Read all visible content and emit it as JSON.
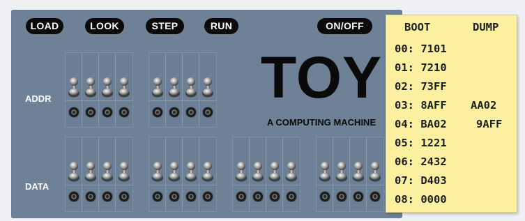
{
  "buttons": {
    "load": "LOAD",
    "look": "LOOK",
    "step": "STEP",
    "run": "RUN",
    "power": "ON/OFF"
  },
  "rows": {
    "addr": "ADDR",
    "data": "DATA"
  },
  "title": "TOY",
  "subtitle": "A COMPUTING MACHINE",
  "note": {
    "header_boot": "BOOT",
    "header_dump": "DUMP",
    "lines": [
      "00: 7101",
      "01: 7210",
      "02: 73FF",
      "03: 8AFF",
      "04: BA02",
      "05: 1221",
      "06: 2432",
      "07: D403",
      "08: 0000"
    ],
    "dump": [
      "AA02",
      "9AFF"
    ]
  },
  "colors": {
    "panel": "#6e8196",
    "button": "#0b0b0b",
    "note": "#fbf0a0"
  },
  "icons": {
    "switch": "toggle-switch-icon",
    "light": "indicator-light-icon"
  }
}
